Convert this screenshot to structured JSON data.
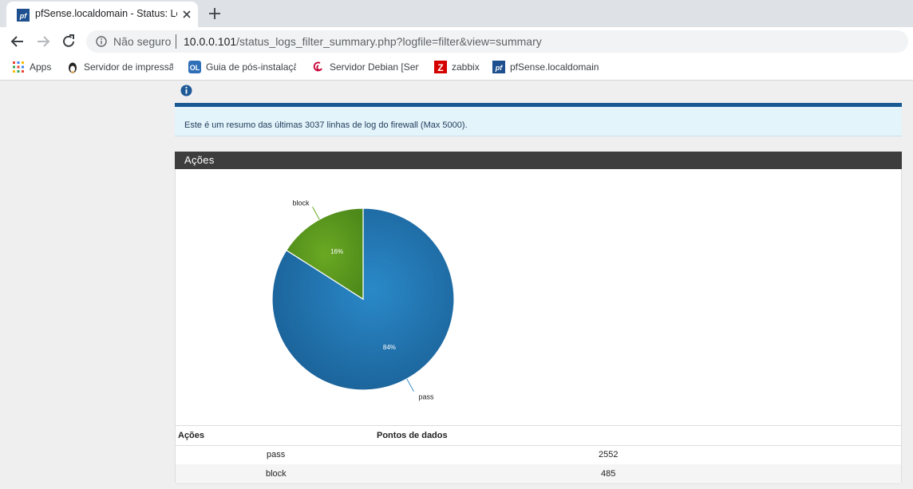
{
  "browser": {
    "tab_title": "pfSense.localdomain - Status: Logs: Firewall",
    "address": {
      "security_label": "Não seguro",
      "host": "10.0.0.101",
      "path": "/status_logs_filter_summary.php?logfile=filter&view=summary"
    },
    "bookmarks": [
      {
        "label": "Apps",
        "icon": "apps-grid-icon"
      },
      {
        "label": "Servidor de impressão",
        "icon": "penguin-icon"
      },
      {
        "label": "Guia de pós-instalação",
        "icon": "ol-icon"
      },
      {
        "label": "Servidor Debian [Serv",
        "icon": "debian-swirl-icon"
      },
      {
        "label": "zabbix",
        "icon": "zabbix-icon"
      },
      {
        "label": "pfSense.localdomain",
        "icon": "pfsense-icon"
      }
    ]
  },
  "alert": {
    "text": "Este é um resumo das últimas 3037 linhas de log do firewall (Max 5000)."
  },
  "panel": {
    "title": "Ações"
  },
  "chart_data": {
    "type": "pie",
    "categories": [
      "pass",
      "block"
    ],
    "values": [
      2552,
      485
    ],
    "percent_labels": [
      "84%",
      "16%"
    ],
    "colors": [
      "#1f77b4",
      "#5b9a1e"
    ]
  },
  "table": {
    "headers": [
      "Ações",
      "Pontos de dados"
    ],
    "rows": [
      {
        "action": "pass",
        "count": "2552"
      },
      {
        "action": "block",
        "count": "485"
      }
    ]
  }
}
